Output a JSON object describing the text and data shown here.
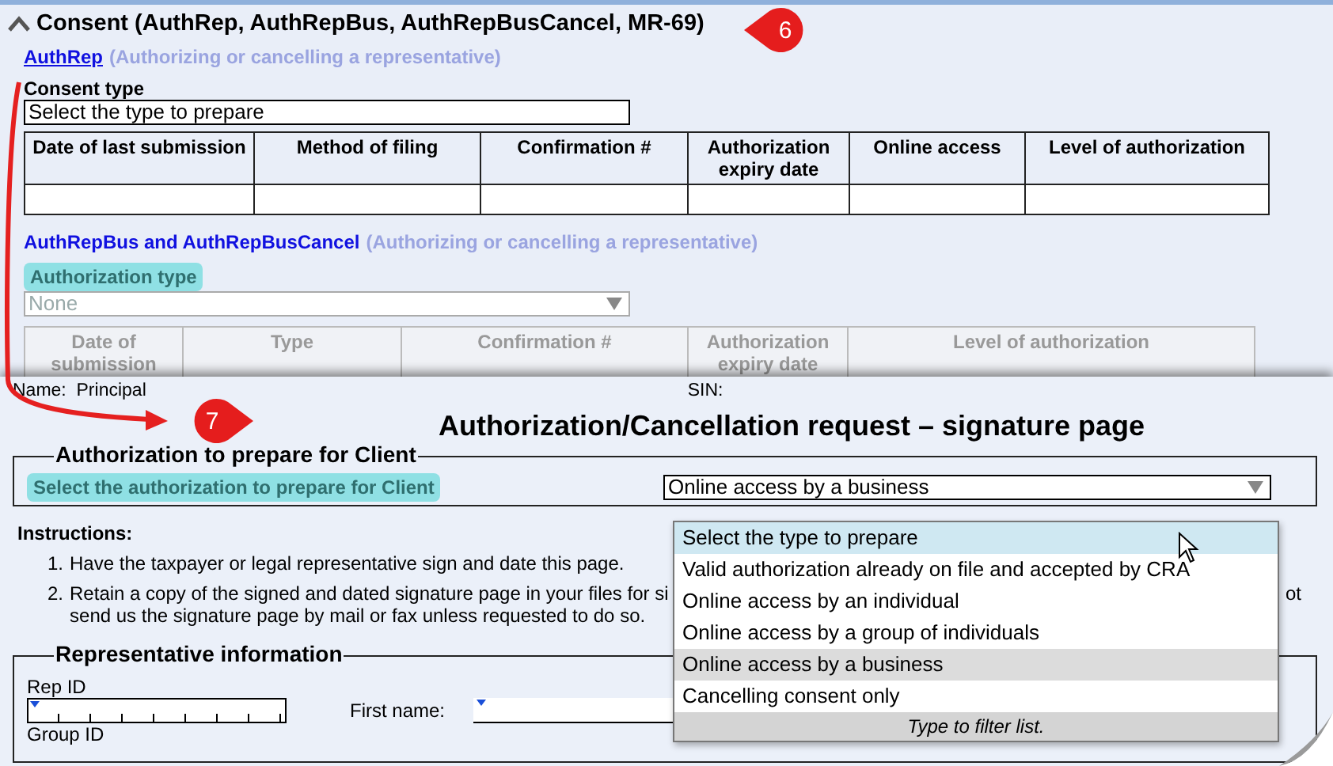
{
  "consent_section": {
    "expanded": true,
    "title": "Consent (AuthRep, AuthRepBus, AuthRepBusCancel, MR-69)",
    "authrep": {
      "link": "AuthRep",
      "note": "(Authorizing or cancelling a representative)",
      "field_label": "Consent type",
      "field_value": "Select the type to prepare",
      "columns": [
        "Date of last submission",
        "Method of filing",
        "Confirmation #",
        "Authorization expiry date",
        "Online access",
        "Level of authorization"
      ]
    },
    "authrepbus": {
      "heading": "AuthRepBus and AuthRepBusCancel",
      "note": "(Authorizing or cancelling a representative)",
      "field_label": "Authorization type",
      "label_highlighted": true,
      "field_value": "None",
      "disabled": true,
      "columns": [
        "Date of submission",
        "Type",
        "Confirmation #",
        "Authorization expiry date",
        "Level of authorization"
      ]
    }
  },
  "callouts": [
    {
      "number": "6"
    },
    {
      "number": "7"
    }
  ],
  "signature_page": {
    "name_label": "Name:",
    "name_value": "Principal",
    "sin_label": "SIN:",
    "title": "Authorization/Cancellation request – signature page",
    "auth_group": {
      "legend": "Authorization to prepare for Client",
      "label": "Select the authorization to prepare for Client",
      "label_highlighted": true,
      "value": "Online access by a business",
      "open": true,
      "options": [
        {
          "label": "Select the type to prepare",
          "selected": false,
          "hovered": true
        },
        {
          "label": "Valid authorization already on file and accepted by CRA",
          "selected": false,
          "hovered": false
        },
        {
          "label": "Online access by an individual",
          "selected": false,
          "hovered": false
        },
        {
          "label": "Online access by a group of individuals",
          "selected": false,
          "hovered": false
        },
        {
          "label": "Online access by a business",
          "selected": true,
          "hovered": false
        },
        {
          "label": "Cancelling consent only",
          "selected": false,
          "hovered": false
        }
      ],
      "filter_hint": "Type to filter list."
    },
    "instructions": {
      "heading": "Instructions:",
      "items": [
        {
          "number": "1.",
          "lines": [
            "Have the taxpayer or legal representative sign and date this page."
          ]
        },
        {
          "number": "2.",
          "lines": [
            "Retain a copy of the signed and dated signature page in your files for si",
            "send us the signature page by mail or fax unless requested to do so."
          ],
          "tail": "ot"
        }
      ]
    },
    "rep_group": {
      "legend": "Representative information",
      "rep_id_label": "Rep ID",
      "first_name_label": "First name:",
      "group_id_label": "Group ID"
    }
  }
}
